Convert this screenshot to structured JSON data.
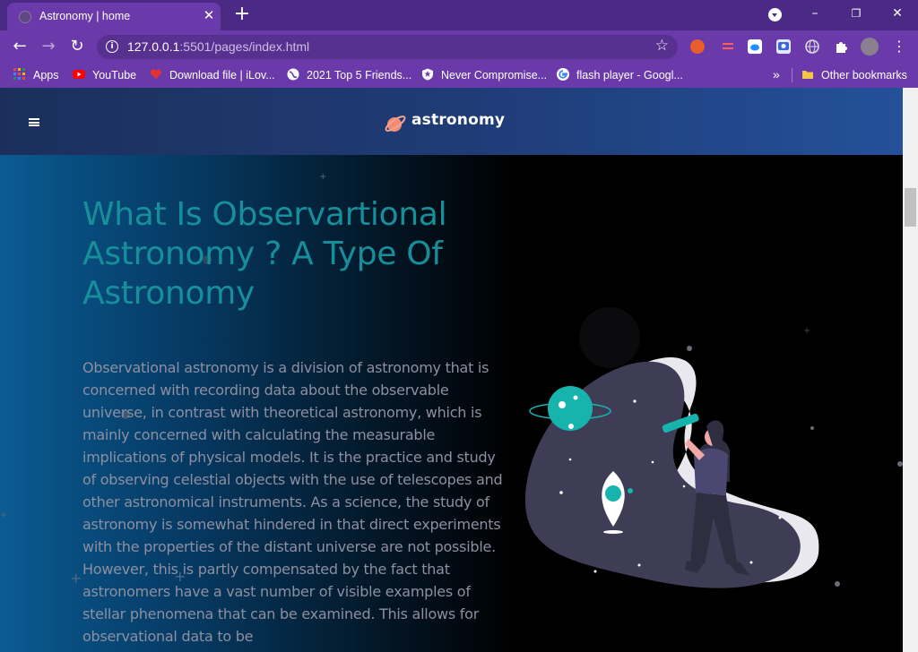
{
  "browser": {
    "tab_title": "Astronomy | home",
    "tab_close": "✕",
    "new_tab": "+",
    "url_host": "127.0.0.1",
    "url_rest": ":5501/pages/index.html",
    "window_controls": {
      "minimize": "–",
      "maximize": "❐",
      "close": "✕"
    },
    "nav": {
      "back": "←",
      "forward": "→",
      "reload": "↻"
    }
  },
  "bookmarks": {
    "items": [
      {
        "label": "Apps",
        "icon": "apps-grid-icon",
        "color": "#e34c3c"
      },
      {
        "label": "YouTube",
        "icon": "youtube-icon",
        "color": "#ff0000"
      },
      {
        "label": "Download file | iLov...",
        "icon": "heart-icon",
        "color": "#e5322d"
      },
      {
        "label": "2021 Top 5 Friends...",
        "icon": "globe-icon",
        "color": "#ffffff"
      },
      {
        "label": "Never Compromise...",
        "icon": "shield-icon",
        "color": "#ffffff"
      },
      {
        "label": "flash player - Googl...",
        "icon": "google-icon",
        "color": "#4285f4"
      }
    ],
    "more": "»",
    "other_bookmarks": "Other bookmarks"
  },
  "site": {
    "logo_text": "astronomy",
    "heading": "What Is Observartional Astronomy ? A Type Of Astronomy",
    "paragraph": "Observational astronomy is a division of astronomy that is concerned with recording data about the observable universe, in contrast with theoretical astronomy, which is mainly concerned with calculating the measurable implications of physical models. It is the practice and study of observing celestial objects with the use of telescopes and other astronomical instruments. As a science, the study of astronomy is somewhat hindered in that direct experiments with the properties of the distant universe are not possible. However, this is partly compensated by the fact that astronomers have a vast number of visible examples of stellar phenomena that can be examined. This allows for observational data to be"
  },
  "colors": {
    "chrome_dark": "#4b2a86",
    "chrome": "#6a3aab",
    "heading": "#168f9a",
    "accent_teal": "#17b3ad",
    "body_text": "#8e8fa0"
  }
}
